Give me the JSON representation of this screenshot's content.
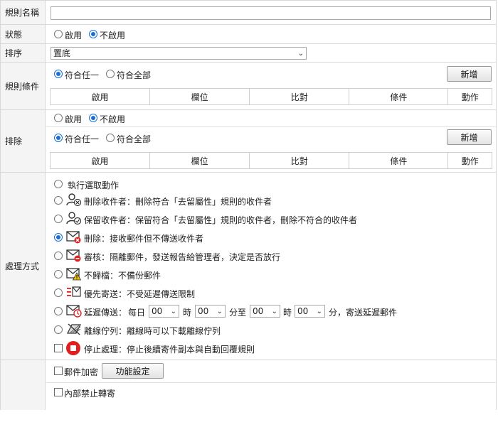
{
  "labels": {
    "rule_name": "規則名稱",
    "status": "狀態",
    "order": "排序",
    "conditions": "規則條件",
    "exclude": "排除",
    "action": "處理方式"
  },
  "status": {
    "enabled": "啟用",
    "disabled": "不啟用"
  },
  "order": {
    "selected": "置底"
  },
  "conditions": {
    "any": "符合任一",
    "all": "符合全部",
    "add_button": "新增",
    "columns": [
      "啟用",
      "欄位",
      "比對",
      "條件",
      "動作"
    ]
  },
  "exclude": {
    "enabled": "啟用",
    "disabled": "不啟用",
    "any": "符合任一",
    "all": "符合全部",
    "add_button": "新增",
    "columns": [
      "啟用",
      "欄位",
      "比對",
      "條件",
      "動作"
    ]
  },
  "actions": {
    "select": "執行選取動作",
    "delete_recipient": "刪除收件者：刪除符合「去留屬性」規則的收件者",
    "keep_recipient": "保留收件者：保留符合「去留屬性」規則的收件者，刪除不符合的收件者",
    "delete": "刪除：接收郵件但不傳送收件者",
    "review": "審核：隔離郵件，發送報告給管理者，決定是否放行",
    "no_archive": "不歸檔：不備份郵件",
    "priority": "優先寄送：不受延遲傳送限制",
    "delay_label": "延遲傳送：",
    "delay_daily": "每日",
    "delay_from_h": "00",
    "delay_h1": "時",
    "delay_from_m": "00",
    "delay_to": "分至",
    "delay_to_h": "00",
    "delay_h2": "時",
    "delay_to_m": "00",
    "delay_tail": "分，寄送延遲郵件",
    "offline": "離線佇列：離線時可以下載離線佇列",
    "stop": "停止處理：停止後續寄件副本與自動回覆規則"
  },
  "extra": {
    "encrypt": "郵件加密",
    "settings_button": "功能設定",
    "no_forward": "內部禁止轉寄"
  },
  "colors": {
    "accent": "#1a6fd6",
    "stop": "#e02020",
    "warn": "#f2c200"
  }
}
